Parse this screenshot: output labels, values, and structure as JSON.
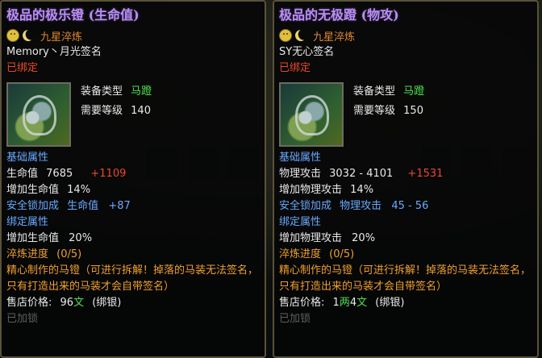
{
  "left": {
    "title": "极品的极乐镫 (生命值)",
    "grade": "九星淬炼",
    "signer": "Memory丶月光签名",
    "bound": "已绑定",
    "equip_type_label": "装备类型",
    "equip_type_value": "马蹬",
    "level_label": "需要等级",
    "level_value": "140",
    "base_section": "基础属性",
    "stat_name": "生命值",
    "stat_value": "7685",
    "stat_bonus": "+1109",
    "pct_label": "增加生命值",
    "pct_value": "14%",
    "lock_label": "安全锁加成",
    "lock_stat": "生命值",
    "lock_value": "+87",
    "bind_section": "绑定属性",
    "bind_stat": "增加生命值",
    "bind_value": "20%",
    "refine_label": "淬炼进度",
    "refine_value": "(0/5)",
    "desc": "精心制作的马镫（可进行拆解！掉落的马装无法签名，只有打造出来的马装才会自带签名）",
    "price_label": "售店价格:",
    "price_amount": "96",
    "price_unit": "文",
    "price_note": "(绑银)",
    "cut_text": "已加锁"
  },
  "right": {
    "title": "极品的无极蹬 (物攻)",
    "grade": "九星淬炼",
    "signer": "SY无心签名",
    "bound": "已绑定",
    "equip_type_label": "装备类型",
    "equip_type_value": "马蹬",
    "level_label": "需要等级",
    "level_value": "150",
    "base_section": "基础属性",
    "stat_name": "物理攻击",
    "stat_value": "3032 - 4101",
    "stat_bonus": "+1531",
    "pct_label": "增加物理攻击",
    "pct_value": "14%",
    "lock_label": "安全锁加成",
    "lock_stat": "物理攻击",
    "lock_value": "45 - 56",
    "bind_section": "绑定属性",
    "bind_stat": "增加物理攻击",
    "bind_value": "20%",
    "refine_label": "淬炼进度",
    "refine_value": "(0/5)",
    "desc": "精心制作的马镫（可进行拆解！掉落的马装无法签名，只有打造出来的马装才会自带签名）",
    "price_label": "售店价格:",
    "price_amount1": "1",
    "price_unit1": "两",
    "price_amount2": "4",
    "price_unit2": "文",
    "price_note": "(绑银)",
    "cut_text": "已加锁"
  },
  "colors": {
    "title": "#b890f0",
    "grade": "#e08830",
    "bound": "#e84a2a",
    "section": "#6aa8ff",
    "bonus": "#e84a2a",
    "green": "#50e050",
    "desc": "#f0a030"
  }
}
